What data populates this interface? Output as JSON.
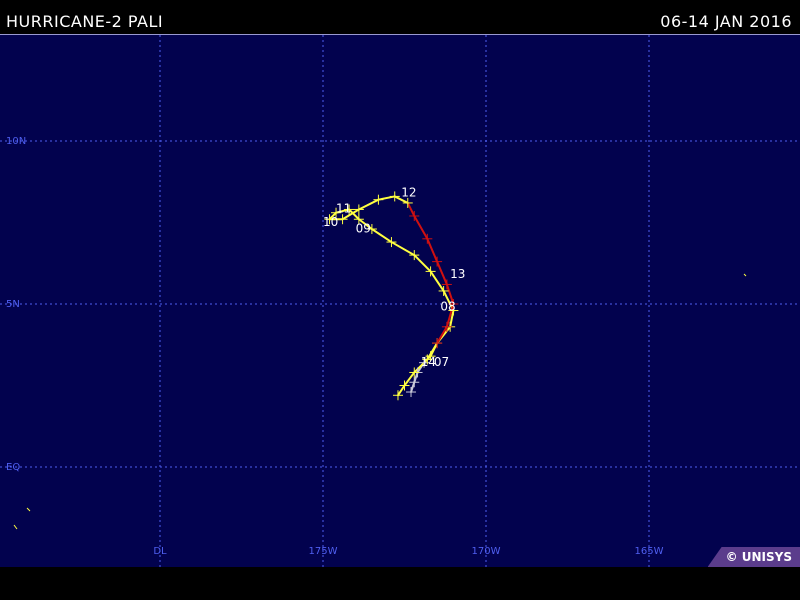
{
  "header": {
    "storm_title": "HURRICANE-2 PALI",
    "date_range": "06-14  JAN 2016"
  },
  "map": {
    "lat_labels": [
      {
        "lat": 10,
        "text": "10N"
      },
      {
        "lat": 5,
        "text": "5N"
      },
      {
        "lat": 0,
        "text": "EQ"
      }
    ],
    "lon_labels": [
      {
        "lon": 180,
        "text": "DL"
      },
      {
        "lon": 175,
        "text": "175W"
      },
      {
        "lon": 170,
        "text": "170W"
      },
      {
        "lon": 165,
        "text": "165W"
      }
    ],
    "grid_color": "#4f5ff0",
    "ocean_color": "#02024e"
  },
  "track": {
    "colors": {
      "tropical_storm": "#ffff40",
      "hurricane": "#d01010",
      "depression": "#c8c8d8"
    },
    "points": [
      {
        "lat": 2.3,
        "lon": 172.3,
        "status": "depression"
      },
      {
        "lat": 2.6,
        "lon": 172.2,
        "status": "depression"
      },
      {
        "lat": 2.9,
        "lon": 172.1,
        "status": "depression"
      },
      {
        "lat": 3.2,
        "lon": 171.9,
        "status": "depression"
      },
      {
        "lat": 3.4,
        "lon": 171.7,
        "status": "tropical_storm"
      },
      {
        "lat": 3.8,
        "lon": 171.5,
        "status": "tropical_storm"
      },
      {
        "lat": 4.3,
        "lon": 171.1,
        "status": "tropical_storm"
      },
      {
        "lat": 4.8,
        "lon": 171.0,
        "status": "tropical_storm"
      },
      {
        "lat": 5.4,
        "lon": 171.3,
        "status": "tropical_storm"
      },
      {
        "lat": 6.0,
        "lon": 171.7,
        "status": "tropical_storm"
      },
      {
        "lat": 6.5,
        "lon": 172.2,
        "status": "tropical_storm"
      },
      {
        "lat": 6.9,
        "lon": 172.9,
        "status": "tropical_storm"
      },
      {
        "lat": 7.3,
        "lon": 173.5,
        "status": "tropical_storm"
      },
      {
        "lat": 7.6,
        "lon": 173.9,
        "status": "tropical_storm"
      },
      {
        "lat": 7.9,
        "lon": 174.2,
        "status": "tropical_storm"
      },
      {
        "lat": 7.8,
        "lon": 174.6,
        "status": "tropical_storm"
      },
      {
        "lat": 7.6,
        "lon": 174.8,
        "status": "tropical_storm"
      },
      {
        "lat": 7.6,
        "lon": 174.4,
        "status": "tropical_storm"
      },
      {
        "lat": 7.9,
        "lon": 173.9,
        "status": "tropical_storm"
      },
      {
        "lat": 8.2,
        "lon": 173.3,
        "status": "tropical_storm"
      },
      {
        "lat": 8.3,
        "lon": 172.8,
        "status": "tropical_storm"
      },
      {
        "lat": 8.1,
        "lon": 172.4,
        "status": "tropical_storm"
      },
      {
        "lat": 7.7,
        "lon": 172.2,
        "status": "hurricane"
      },
      {
        "lat": 7.0,
        "lon": 171.8,
        "status": "hurricane"
      },
      {
        "lat": 6.3,
        "lon": 171.5,
        "status": "hurricane"
      },
      {
        "lat": 5.6,
        "lon": 171.2,
        "status": "hurricane"
      },
      {
        "lat": 5.0,
        "lon": 171.0,
        "status": "hurricane"
      },
      {
        "lat": 4.3,
        "lon": 171.2,
        "status": "hurricane"
      },
      {
        "lat": 3.8,
        "lon": 171.5,
        "status": "hurricane"
      },
      {
        "lat": 3.3,
        "lon": 171.8,
        "status": "tropical_storm"
      },
      {
        "lat": 2.9,
        "lon": 172.2,
        "status": "tropical_storm"
      },
      {
        "lat": 2.5,
        "lon": 172.5,
        "status": "tropical_storm"
      },
      {
        "lat": 2.2,
        "lon": 172.7,
        "status": "tropical_storm"
      }
    ],
    "day_labels": [
      {
        "text": "07",
        "lat": 3.1,
        "lon": 171.6
      },
      {
        "text": "08",
        "lat": 4.8,
        "lon": 171.4
      },
      {
        "text": "09",
        "lat": 7.2,
        "lon": 174.0
      },
      {
        "text": "10",
        "lat": 7.4,
        "lon": 175.0
      },
      {
        "text": "11",
        "lat": 7.8,
        "lon": 174.6
      },
      {
        "text": "12",
        "lat": 8.3,
        "lon": 172.6
      },
      {
        "text": "13",
        "lat": 5.8,
        "lon": 171.1
      },
      {
        "text": "14",
        "lat": 3.1,
        "lon": 172.0
      }
    ]
  },
  "credit": "© UNISYS"
}
